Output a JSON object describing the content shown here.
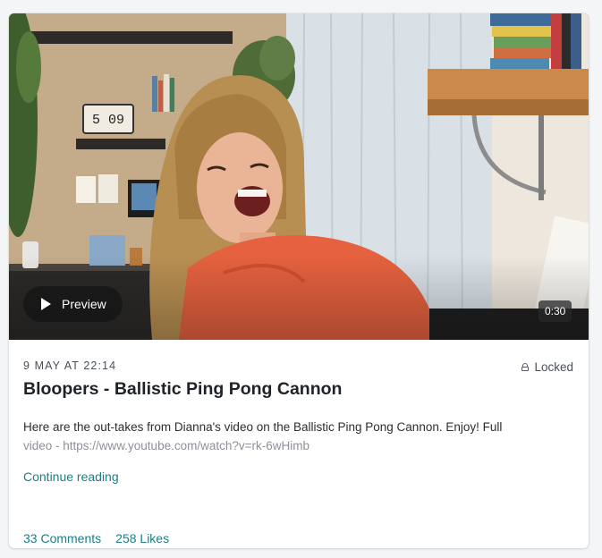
{
  "post": {
    "date": "9 MAY AT 22:14",
    "lock_label": "Locked",
    "title": "Bloopers - Ballistic Ping Pong Cannon",
    "description_line1": "Here are the out-takes from Dianna's video on the Ballistic Ping Pong Cannon. Enjoy! Full",
    "description_line2": "video - https://www.youtube.com/watch?v=rk-6wHimb",
    "continue_label": "Continue reading",
    "comments_label": "33 Comments",
    "likes_label": "258 Likes"
  },
  "video": {
    "preview_label": "Preview",
    "duration": "0:30",
    "clock_display": "5 09"
  }
}
